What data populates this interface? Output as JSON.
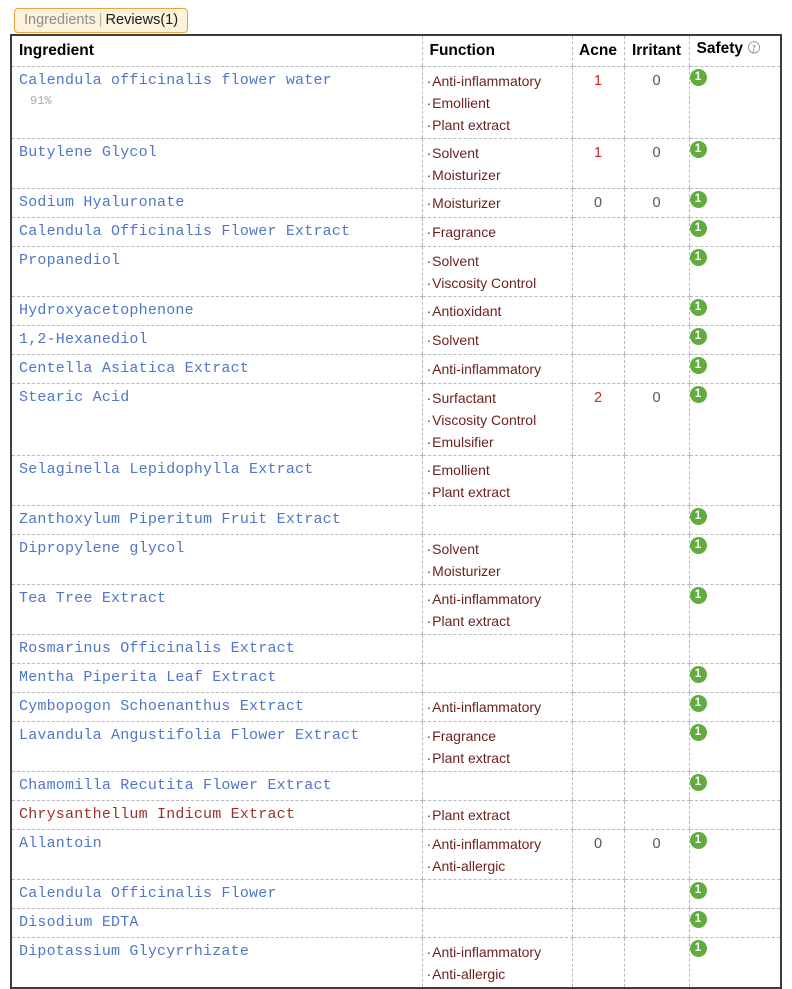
{
  "tabs": {
    "ingredients_label": "Ingredients",
    "separator": "|",
    "reviews_label": "Reviews(1)"
  },
  "table": {
    "columns": {
      "ingredient": "Ingredient",
      "function": "Function",
      "acne": "Acne",
      "irritant": "Irritant",
      "safety": "Safety",
      "safety_help_icon": "question-mark-help-icon"
    },
    "colors": {
      "ingredient_link": "#5076c8",
      "ingredient_warn": "#9a3324",
      "function_text": "#6b1f1f",
      "acne_value": "#cc2222",
      "safety_badge": "#62ab3e",
      "tab_border": "#e8a33d",
      "tab_background": "#fdf3dc"
    },
    "rows": [
      {
        "name": "Calendula officinalis flower water",
        "percent": "91%",
        "warn": false,
        "functions": [
          "Anti-inflammatory",
          "Emollient",
          "Plant extract"
        ],
        "acne": "1",
        "irritant": "0",
        "safety": "1"
      },
      {
        "name": "Butylene Glycol",
        "percent": "",
        "warn": false,
        "functions": [
          "Solvent",
          "Moisturizer"
        ],
        "acne": "1",
        "irritant": "0",
        "safety": "1"
      },
      {
        "name": "Sodium Hyaluronate",
        "percent": "",
        "warn": false,
        "functions": [
          "Moisturizer"
        ],
        "acne": "0",
        "irritant": "0",
        "safety": "1"
      },
      {
        "name": "Calendula Officinalis Flower Extract",
        "percent": "",
        "warn": false,
        "functions": [
          "Fragrance"
        ],
        "acne": "",
        "irritant": "",
        "safety": "1"
      },
      {
        "name": "Propanediol",
        "percent": "",
        "warn": false,
        "functions": [
          "Solvent",
          "Viscosity Control"
        ],
        "acne": "",
        "irritant": "",
        "safety": "1"
      },
      {
        "name": "Hydroxyacetophenone",
        "percent": "",
        "warn": false,
        "functions": [
          "Antioxidant"
        ],
        "acne": "",
        "irritant": "",
        "safety": "1"
      },
      {
        "name": "1,2-Hexanediol",
        "percent": "",
        "warn": false,
        "functions": [
          "Solvent"
        ],
        "acne": "",
        "irritant": "",
        "safety": "1"
      },
      {
        "name": "Centella Asiatica Extract",
        "percent": "",
        "warn": false,
        "functions": [
          "Anti-inflammatory"
        ],
        "acne": "",
        "irritant": "",
        "safety": "1"
      },
      {
        "name": "Stearic Acid",
        "percent": "",
        "warn": false,
        "functions": [
          "Surfactant",
          "Viscosity Control",
          "Emulsifier"
        ],
        "acne": "2",
        "irritant": "0",
        "safety": "1"
      },
      {
        "name": "Selaginella Lepidophylla Extract",
        "percent": "",
        "warn": false,
        "functions": [
          "Emollient",
          "Plant extract"
        ],
        "acne": "",
        "irritant": "",
        "safety": ""
      },
      {
        "name": "Zanthoxylum Piperitum Fruit Extract",
        "percent": "",
        "warn": false,
        "functions": [],
        "acne": "",
        "irritant": "",
        "safety": "1"
      },
      {
        "name": "Dipropylene glycol",
        "percent": "",
        "warn": false,
        "functions": [
          "Solvent",
          "Moisturizer"
        ],
        "acne": "",
        "irritant": "",
        "safety": "1"
      },
      {
        "name": "Tea Tree Extract",
        "percent": "",
        "warn": false,
        "functions": [
          "Anti-inflammatory",
          "Plant extract"
        ],
        "acne": "",
        "irritant": "",
        "safety": "1"
      },
      {
        "name": "Rosmarinus Officinalis Extract",
        "percent": "",
        "warn": false,
        "functions": [],
        "acne": "",
        "irritant": "",
        "safety": ""
      },
      {
        "name": "Mentha Piperita Leaf Extract",
        "percent": "",
        "warn": false,
        "functions": [],
        "acne": "",
        "irritant": "",
        "safety": "1"
      },
      {
        "name": "Cymbopogon Schoenanthus Extract",
        "percent": "",
        "warn": false,
        "functions": [
          "Anti-inflammatory"
        ],
        "acne": "",
        "irritant": "",
        "safety": "1"
      },
      {
        "name": "Lavandula Angustifolia Flower Extract",
        "percent": "",
        "warn": false,
        "functions": [
          "Fragrance",
          "Plant extract"
        ],
        "acne": "",
        "irritant": "",
        "safety": "1"
      },
      {
        "name": "Chamomilla Recutita Flower Extract",
        "percent": "",
        "warn": false,
        "functions": [],
        "acne": "",
        "irritant": "",
        "safety": "1"
      },
      {
        "name": "Chrysanthellum Indicum Extract",
        "percent": "",
        "warn": true,
        "functions": [
          "Plant extract"
        ],
        "acne": "",
        "irritant": "",
        "safety": ""
      },
      {
        "name": "Allantoin",
        "percent": "",
        "warn": false,
        "functions": [
          "Anti-inflammatory",
          "Anti-allergic"
        ],
        "acne": "0",
        "irritant": "0",
        "safety": "1"
      },
      {
        "name": "Calendula Officinalis Flower",
        "percent": "",
        "warn": false,
        "functions": [],
        "acne": "",
        "irritant": "",
        "safety": "1"
      },
      {
        "name": "Disodium EDTA",
        "percent": "",
        "warn": false,
        "functions": [],
        "acne": "",
        "irritant": "",
        "safety": "1"
      },
      {
        "name": "Dipotassium Glycyrrhizate",
        "percent": "",
        "warn": false,
        "functions": [
          "Anti-inflammatory",
          "Anti-allergic"
        ],
        "acne": "",
        "irritant": "",
        "safety": "1"
      }
    ]
  }
}
